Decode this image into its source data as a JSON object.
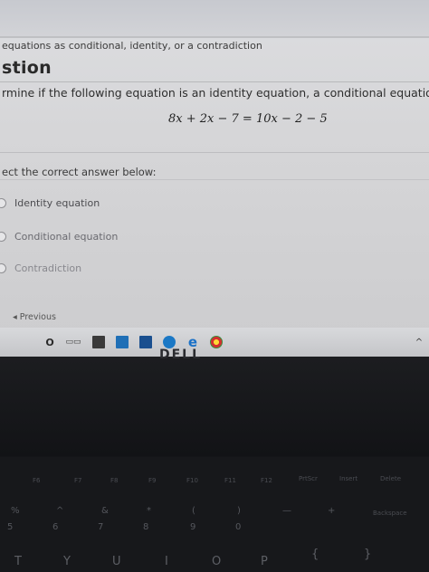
{
  "breadcrumb": "equations as conditional, identity, or a contradiction",
  "section_title": "stion",
  "instruction": "rmine if the following equation is an identity equation, a conditional equation, or a contradiction.",
  "equation": "8x + 2x − 7 = 10x − 2 − 5",
  "prompt": "ect the correct answer below:",
  "options": [
    {
      "label": "Identity equation"
    },
    {
      "label": "Conditional equation"
    },
    {
      "label": "Contradiction"
    }
  ],
  "previous_label": "◂ Previous",
  "taskbar": {
    "icons": [
      "search-icon",
      "task-view-icon",
      "store-icon",
      "shopping-bag-icon",
      "mail-icon",
      "globe-icon",
      "edge-icon",
      "chrome-icon"
    ],
    "edge_glyph": "e",
    "search_glyph": "O",
    "chevron": "^"
  },
  "keyboard": {
    "fkeys": [
      "F6",
      "F7",
      "F8",
      "F9",
      "F10",
      "F11",
      "F12",
      "PrtScr",
      "Insert",
      "Delete"
    ],
    "number_row": [
      "5",
      "6",
      "7",
      "8",
      "9",
      "0"
    ],
    "symbols": [
      "%",
      "^",
      "&",
      "*",
      "(",
      ")",
      "—",
      "+"
    ],
    "letters": [
      "T",
      "Y",
      "U",
      "I",
      "O",
      "P",
      "{",
      "}"
    ],
    "backspace": "Backspace"
  }
}
